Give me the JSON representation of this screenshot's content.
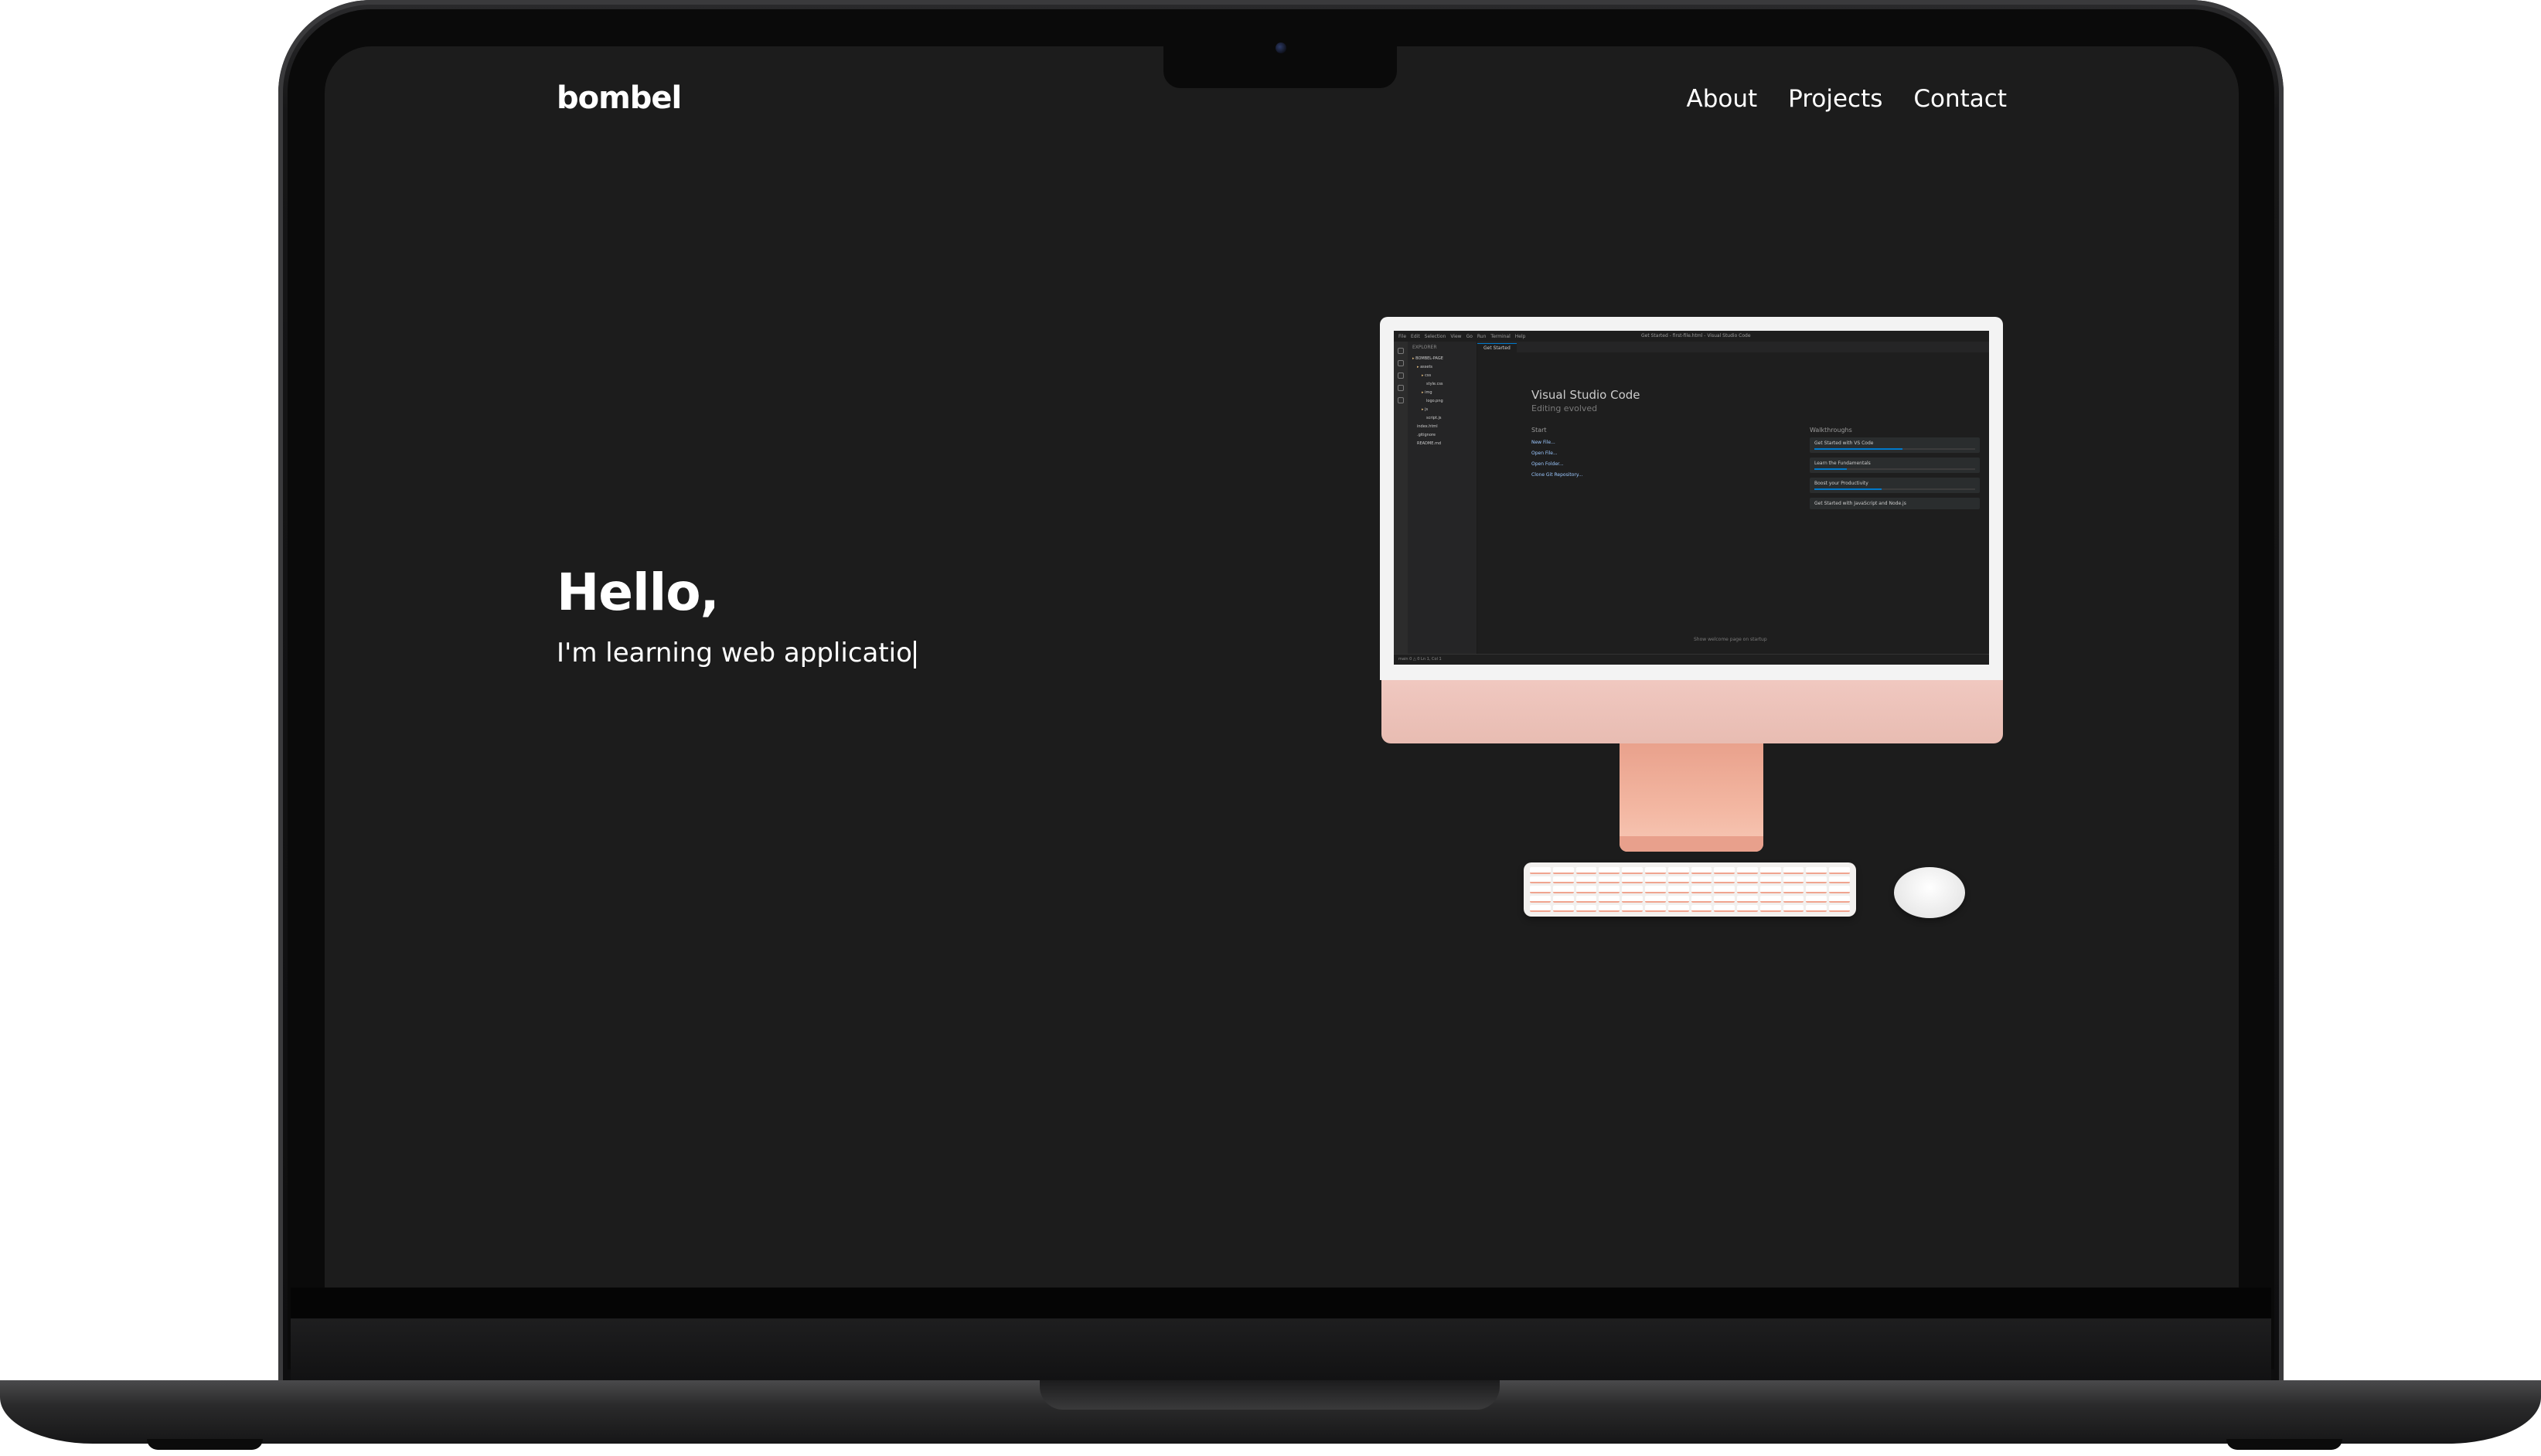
{
  "site": {
    "logo": "bombel",
    "nav": [
      "About",
      "Projects",
      "Contact"
    ],
    "hero": {
      "title": "Hello,",
      "subtitle": "I'm learning web applicatio"
    }
  },
  "vscode": {
    "menu": [
      "File",
      "Edit",
      "Selection",
      "View",
      "Go",
      "Run",
      "Terminal",
      "Help"
    ],
    "window_title": "Get Started - first-file.html - Visual Studio Code",
    "tab": "Get Started",
    "welcome_title": "Visual Studio Code",
    "welcome_subtitle": "Editing evolved",
    "start_heading": "Start",
    "start_items": [
      "New File...",
      "Open File...",
      "Open Folder...",
      "Clone Git Repository..."
    ],
    "walkthroughs_heading": "Walkthroughs",
    "walkthroughs": [
      {
        "label": "Get Started with VS Code",
        "progress": 0.55
      },
      {
        "label": "Learn the Fundamentals",
        "progress": 0.2
      },
      {
        "label": "Boost your Productivity",
        "progress": 0.42
      },
      {
        "label": "Get Started with JavaScript and Node.js",
        "progress": 0
      }
    ],
    "show_on_startup": "Show welcome page on startup",
    "sidebar_title": "EXPLORER",
    "tree": [
      "BOMBEL-PAGE",
      "assets",
      "css",
      "style.css",
      "img",
      "logo.png",
      "js",
      "script.js",
      "index.html",
      ".gitignore",
      "README.md"
    ],
    "status_text": "main  0 △ 0  Ln 1, Col 1"
  }
}
